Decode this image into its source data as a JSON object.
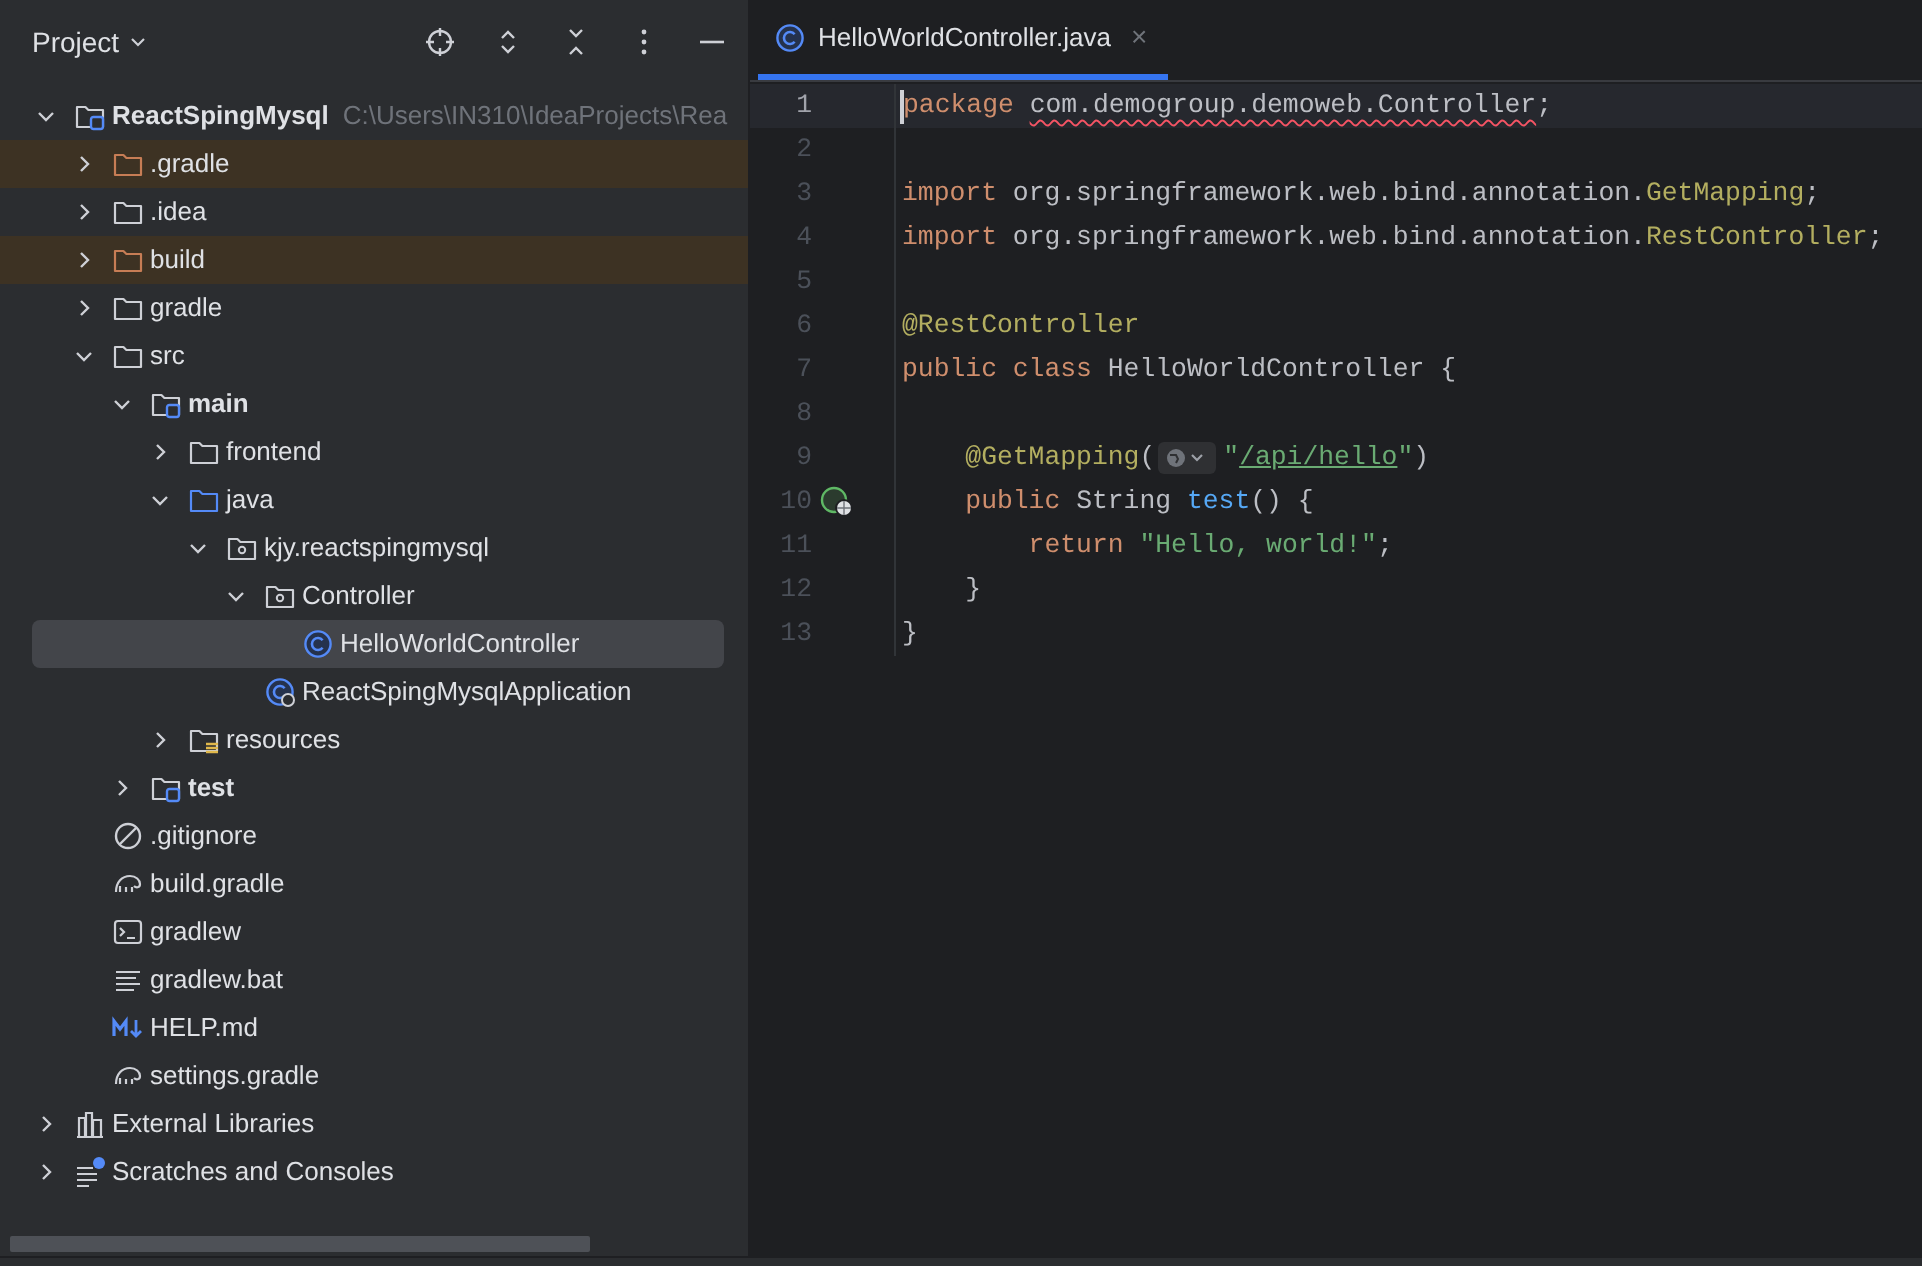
{
  "sidebar": {
    "title": "Project",
    "tree": [
      {
        "label": "ReactSpingMysql",
        "path": "C:\\Users\\IN310\\IdeaProjects\\Rea",
        "kind": "module",
        "expanded": true,
        "excluded": false,
        "selected": false,
        "children": [
          {
            "label": ".gradle",
            "kind": "folder",
            "expanded": false,
            "excluded": true,
            "selected": false
          },
          {
            "label": ".idea",
            "kind": "folder",
            "expanded": false,
            "excluded": false,
            "selected": false
          },
          {
            "label": "build",
            "kind": "folder",
            "expanded": false,
            "excluded": true,
            "selected": false
          },
          {
            "label": "gradle",
            "kind": "folder",
            "expanded": false,
            "excluded": false,
            "selected": false
          },
          {
            "label": "src",
            "kind": "folder",
            "expanded": true,
            "excluded": false,
            "selected": false,
            "children": [
              {
                "label": "main",
                "kind": "module",
                "expanded": true,
                "excluded": false,
                "selected": false,
                "children": [
                  {
                    "label": "frontend",
                    "kind": "folder",
                    "expanded": false,
                    "excluded": false,
                    "selected": false
                  },
                  {
                    "label": "java",
                    "kind": "source",
                    "expanded": true,
                    "excluded": false,
                    "selected": false,
                    "children": [
                      {
                        "label": "kjy.reactspingmysql",
                        "kind": "package",
                        "expanded": true,
                        "excluded": false,
                        "selected": false,
                        "children": [
                          {
                            "label": "Controller",
                            "kind": "package",
                            "expanded": true,
                            "excluded": false,
                            "selected": false,
                            "children": [
                              {
                                "label": "HelloWorldController",
                                "kind": "class",
                                "excluded": false,
                                "selected": true
                              }
                            ]
                          },
                          {
                            "label": "ReactSpingMysqlApplication",
                            "kind": "application",
                            "excluded": false,
                            "selected": false
                          }
                        ]
                      }
                    ]
                  },
                  {
                    "label": "resources",
                    "kind": "resources",
                    "expanded": false,
                    "excluded": false,
                    "selected": false
                  }
                ]
              },
              {
                "label": "test",
                "kind": "module",
                "expanded": false,
                "excluded": false,
                "selected": false
              }
            ]
          },
          {
            "label": ".gitignore",
            "kind": "ignore",
            "excluded": false,
            "selected": false
          },
          {
            "label": "build.gradle",
            "kind": "gradle",
            "excluded": false,
            "selected": false
          },
          {
            "label": "gradlew",
            "kind": "shell",
            "excluded": false,
            "selected": false
          },
          {
            "label": "gradlew.bat",
            "kind": "text",
            "excluded": false,
            "selected": false
          },
          {
            "label": "HELP.md",
            "kind": "markdown",
            "excluded": false,
            "selected": false
          },
          {
            "label": "settings.gradle",
            "kind": "gradle",
            "excluded": false,
            "selected": false
          }
        ]
      },
      {
        "label": "External Libraries",
        "kind": "libraries",
        "expanded": false,
        "excluded": false,
        "selected": false
      },
      {
        "label": "Scratches and Consoles",
        "kind": "scratches",
        "expanded": false,
        "excluded": false,
        "selected": false
      }
    ]
  },
  "editor": {
    "tabs": [
      {
        "label": "HelloWorldController.java",
        "close": "×",
        "selected": true
      }
    ],
    "lines": [
      {
        "number": "1",
        "current": true,
        "segments": [
          {
            "kind": "code",
            "tokens": [
              {
                "kind": "keyword",
                "t": "package "
              },
              {
                "kind": "plain",
                "t": "com.demogroup.demoweb.Controller",
                "error": true
              },
              {
                "kind": "plain",
                "t": ";"
              }
            ]
          }
        ]
      },
      {
        "number": "2",
        "current": false
      },
      {
        "number": "3",
        "current": false,
        "segments": [
          {
            "kind": "code",
            "tokens": [
              {
                "kind": "keyword",
                "t": "import "
              },
              {
                "kind": "plain",
                "t": "org.springframework.web.bind.annotation."
              },
              {
                "kind": "annotation",
                "t": "GetMapping"
              },
              {
                "kind": "plain",
                "t": ";"
              }
            ]
          }
        ]
      },
      {
        "number": "4",
        "current": false,
        "segments": [
          {
            "kind": "code",
            "tokens": [
              {
                "kind": "keyword",
                "t": "import "
              },
              {
                "kind": "plain",
                "t": "org.springframework.web.bind.annotation."
              },
              {
                "kind": "annotation",
                "t": "RestController"
              },
              {
                "kind": "plain",
                "t": ";"
              }
            ]
          }
        ]
      },
      {
        "number": "5",
        "current": false
      },
      {
        "number": "6",
        "current": false,
        "segments": [
          {
            "kind": "code",
            "tokens": [
              {
                "kind": "annotation",
                "t": "@RestController"
              }
            ]
          }
        ]
      },
      {
        "number": "7",
        "current": false,
        "segments": [
          {
            "kind": "code",
            "tokens": [
              {
                "kind": "keyword",
                "t": "public class "
              },
              {
                "kind": "plain",
                "t": "HelloWorldController {"
              }
            ]
          }
        ]
      },
      {
        "number": "8",
        "current": false
      },
      {
        "number": "9",
        "current": false,
        "segments": [
          {
            "kind": "code",
            "tokens": [
              {
                "kind": "annotation",
                "t": "    @GetMapping"
              },
              {
                "kind": "plain",
                "t": "("
              }
            ]
          },
          {
            "kind": "hint"
          },
          {
            "kind": "code",
            "tokens": [
              {
                "kind": "string",
                "t": "\""
              },
              {
                "kind": "link",
                "t": "/api/hello"
              },
              {
                "kind": "string",
                "t": "\""
              },
              {
                "kind": "plain",
                "t": ")"
              }
            ]
          }
        ]
      },
      {
        "number": "10",
        "current": false,
        "gutter": {
          "kind": "endpoint"
        },
        "segments": [
          {
            "kind": "code",
            "tokens": [
              {
                "kind": "keyword",
                "t": "    public "
              },
              {
                "kind": "plain",
                "t": "String "
              },
              {
                "kind": "method",
                "t": "test"
              },
              {
                "kind": "plain",
                "t": "() {"
              }
            ]
          }
        ]
      },
      {
        "number": "11",
        "current": false,
        "segments": [
          {
            "kind": "code",
            "tokens": [
              {
                "kind": "keyword",
                "t": "        return "
              },
              {
                "kind": "string",
                "t": "\"Hello, world!\""
              },
              {
                "kind": "plain",
                "t": ";"
              }
            ]
          }
        ]
      },
      {
        "number": "12",
        "current": false,
        "segments": [
          {
            "kind": "code",
            "tokens": [
              {
                "kind": "plain",
                "t": "    }"
              }
            ]
          }
        ]
      },
      {
        "number": "13",
        "current": false,
        "segments": [
          {
            "kind": "code",
            "tokens": [
              {
                "kind": "plain",
                "t": "}"
              }
            ]
          }
        ]
      }
    ]
  }
}
